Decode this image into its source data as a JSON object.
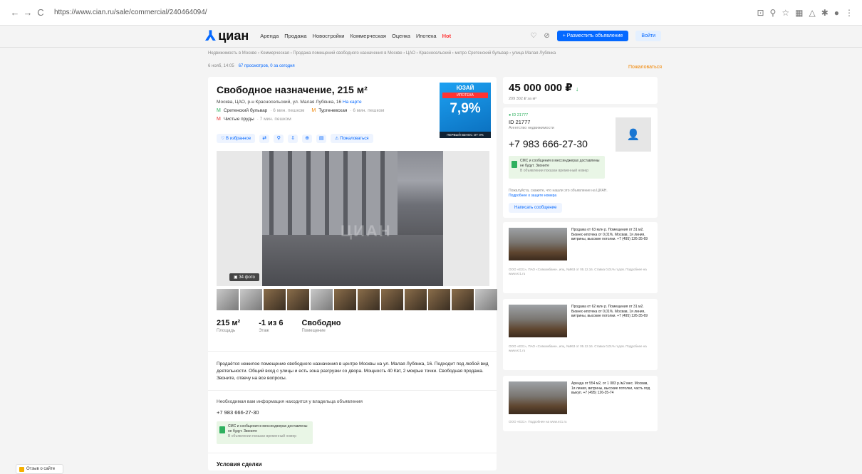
{
  "browser": {
    "back": "←",
    "forward": "→",
    "reload": "C",
    "url": "https://www.cian.ru/sale/commercial/240464094/",
    "ext_icons": [
      "⊡",
      "⚲",
      "☆",
      "▦",
      "△",
      "✱",
      "●",
      "⋮"
    ]
  },
  "header": {
    "logo_mark": "⅄",
    "logo_text": "циан",
    "menu": [
      "Аренда",
      "Продажа",
      "Новостройки",
      "Коммерческая",
      "Оценка",
      "Ипотека"
    ],
    "hot_label": "Hot",
    "post_label": "+ Разместить объявление",
    "login_label": "Войти"
  },
  "breadcrumbs": "Недвижимость в Москве › Коммерческая › Продажа помещений свободного назначения в Москве › ЦАО › Красносельский › метро Сретенский бульвар › улица Малая Лубянка",
  "meta": {
    "date": "6 нояб, 14:05",
    "views": "67 просмотров, 0 за сегодня",
    "complain": "Пожаловаться"
  },
  "listing": {
    "title": "Свободное назначение, 215 м²",
    "address": "Москва, ЦАО, р-н Красносельский, ул. Малая Лубянка, 16",
    "map_link": "На карте",
    "metro": [
      {
        "icon": "М",
        "color": "#2eb05e",
        "name": "Сретенский бульвар",
        "dist": "· 6 мин. пешком"
      },
      {
        "icon": "М",
        "color": "#f08400",
        "name": "Тургеневская",
        "dist": "· 6 мин. пешком"
      },
      {
        "icon": "М",
        "color": "#e83030",
        "name": "Чистые пруды",
        "dist": "· 7 мин. пешком"
      }
    ],
    "actions": {
      "favorite": "♡ В избранное",
      "icons": [
        "⇄",
        "⚲",
        "⇩",
        "⊕",
        "▤"
      ],
      "complain": "⚠ Пожаловаться"
    },
    "photo_count": "▣ 34 фото",
    "watermark": "ЦИАН",
    "facts": [
      {
        "value": "215 м²",
        "label": "Площадь"
      },
      {
        "value": "-1 из 6",
        "label": "Этаж"
      },
      {
        "value": "Свободно",
        "label": "Помещение"
      }
    ],
    "description": "Продаётся нежилое помещение свободного назначения в центре Москвы на ул. Малая Лубянка, 16. Подходит под любой вид деятельности. Общий вход с улицы и есть зона разгрузки со двора. Мощность 40 Квт, 2 мокрые точки. Свободная продажа. Звоните, отвечу на все вопросы.",
    "info_note": "Необходимая вам информация находится у владельца объявления",
    "phone": "+7 983 666-27-30",
    "sms_title": "СМС и сообщения в мессенджерах доставлены не будут. Звоните",
    "sms_sub": "В объявлении показан временный номер",
    "deal_title": "Условия сделки"
  },
  "ad": {
    "brand": "ЮЗАЙ",
    "line": "ИПОТЕКА",
    "rate": "7,9%",
    "foot": "ПЕРВЫЙ ВЗНОС ОТ 0%"
  },
  "price": {
    "value": "45 000 000 ₽",
    "arrow": "↓",
    "per_meter": "209 302 ₽ за м²"
  },
  "agent": {
    "status": "● ID 21777",
    "id": "ID 21777",
    "type": "Агентство недвижимости",
    "phone": "+7 983 666-27-30",
    "sms_title": "СМС и сообщения в мессенджерах доставлены не будут. Звоните",
    "sms_sub": "В объявлении показан временный номер",
    "disclaimer": "Пожалуйста, скажите, что нашли это объявление на ЦИАН.",
    "disclaimer_link": "Подробнее о защите номера",
    "message_button": "Написать сообщение"
  },
  "promos": [
    {
      "text": "Продажа от 63 млн р. Помещения от 31 м2. Бизнес-ипотека от 0,01%. Мосвав, 1я линия, витрины, высокие потолки. +7 (495) 126-35-69",
      "foot": "ООО «ЕЗ1», ПАО «Совкомбанк», ипц. №963 от 05.12.16. Ставка 0,01% годов. Подробнее на www.ez1.ru"
    },
    {
      "text": "Продажа от 62 млн р. Помещения от 31 м2. Бизнес-ипотека от 0,01%. Мосвав, 1я линия, витрины, высокие потолки. +7 (495) 126-35-69",
      "foot": "ООО «ЕЗ1», ПАО «Совкомбанк», ипц. №963 от 05.12.16. Ставка 0,01% годов. Подробнее на www.ez1.ru"
    },
    {
      "text": "Аренда от 554 м2, от 1 083 р./м2 мес. Мосвав, 1я линия, витрины, высокие потолки, часть под выкуп. +7 (495) 126-35-74",
      "foot": "ООО «ЕЗ1». Подробнее на www.ez1.ru"
    }
  ],
  "feedback_label": "Отзыв о сайте"
}
